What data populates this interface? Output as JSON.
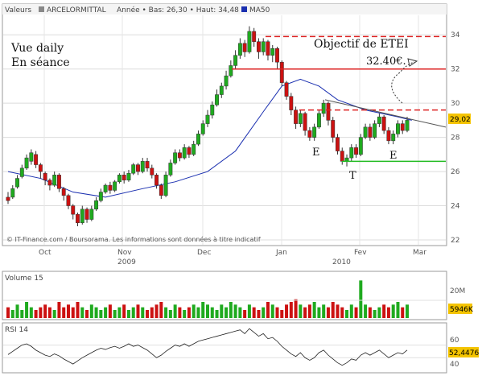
{
  "legend": {
    "label": "Valeurs",
    "name": "ARCELORMITTAL",
    "range": "Année • Bas: 26,30 • Haut: 34,48",
    "ma": "MA50"
  },
  "annotations": {
    "session1": "Vue daily",
    "session2": "En séance",
    "objective": "Objectif de ETEI",
    "target": "32.40€.",
    "e_left": "E",
    "t_bottom": "T",
    "e_right": "E",
    "credits": "© IT-Finance.com / Boursorama. Les informations sont données à titre indicatif"
  },
  "price_axis": {
    "ticks": [
      "22",
      "24",
      "26",
      "28",
      "30",
      "32",
      "34"
    ],
    "last": "29,02"
  },
  "months": [
    "Oct",
    "Nov",
    "Dec",
    "Jan",
    "Fev",
    "Mar"
  ],
  "years": [
    "2009",
    "2010"
  ],
  "volume_panel": {
    "title": "Volume 15",
    "tick": "20M",
    "last": "5946K"
  },
  "rsi_panel": {
    "title": "RSI 14",
    "ticks": [
      "60",
      "40"
    ],
    "last": "52,4476"
  },
  "colors": {
    "up": "#1faa1f",
    "down": "#cc1111",
    "ma": "#1a2fb0",
    "support": "#22bb22",
    "resistance": "#dd2222"
  },
  "chart_data": {
    "type": "candlestick",
    "title": "ARCELORMITTAL",
    "period": "daily, Sep 2009 - Feb 2010",
    "ylim": [
      22,
      35
    ],
    "candles": [
      [
        24.5,
        24.3,
        24.8,
        24.1
      ],
      [
        24.5,
        25.0,
        25.2,
        24.4
      ],
      [
        25.1,
        25.6,
        25.8,
        25.0
      ],
      [
        25.7,
        26.2,
        26.4,
        25.6
      ],
      [
        26.2,
        26.8,
        27.0,
        26.1
      ],
      [
        26.6,
        27.1,
        27.3,
        26.4
      ],
      [
        27.0,
        26.4,
        27.2,
        26.2
      ],
      [
        26.4,
        26.0,
        26.5,
        25.6
      ],
      [
        25.9,
        25.5,
        26.0,
        25.2
      ],
      [
        25.5,
        25.2,
        25.6,
        24.9
      ],
      [
        25.2,
        25.8,
        26.0,
        25.1
      ],
      [
        25.8,
        25.0,
        25.9,
        24.8
      ],
      [
        25.0,
        24.6,
        25.1,
        24.3
      ],
      [
        24.6,
        24.0,
        24.7,
        23.8
      ],
      [
        24.0,
        23.5,
        24.1,
        23.2
      ],
      [
        23.5,
        23.0,
        23.6,
        22.8
      ],
      [
        23.0,
        23.8,
        24.0,
        22.9
      ],
      [
        23.8,
        23.2,
        23.9,
        23.0
      ],
      [
        23.2,
        23.8,
        24.0,
        23.1
      ],
      [
        23.8,
        24.3,
        24.5,
        23.7
      ],
      [
        24.3,
        24.8,
        25.0,
        24.2
      ],
      [
        24.8,
        25.2,
        25.3,
        24.7
      ],
      [
        25.2,
        24.9,
        25.4,
        24.7
      ],
      [
        24.9,
        25.4,
        25.5,
        24.8
      ],
      [
        25.4,
        25.8,
        25.9,
        25.3
      ],
      [
        25.8,
        25.5,
        26.0,
        25.3
      ],
      [
        25.5,
        25.9,
        26.1,
        25.4
      ],
      [
        25.9,
        26.4,
        26.5,
        25.8
      ],
      [
        26.4,
        26.0,
        26.5,
        25.8
      ],
      [
        26.0,
        26.6,
        26.8,
        25.9
      ],
      [
        26.6,
        26.2,
        26.8,
        26.0
      ],
      [
        26.2,
        25.8,
        26.4,
        25.6
      ],
      [
        25.8,
        25.2,
        25.9,
        25.0
      ],
      [
        25.2,
        24.6,
        25.3,
        24.4
      ],
      [
        24.6,
        25.8,
        26.0,
        24.5
      ],
      [
        25.8,
        26.5,
        26.7,
        25.7
      ],
      [
        26.5,
        27.1,
        27.3,
        26.4
      ],
      [
        27.1,
        26.8,
        27.3,
        26.6
      ],
      [
        26.8,
        27.4,
        27.6,
        26.7
      ],
      [
        27.4,
        27.0,
        27.5,
        26.8
      ],
      [
        27.0,
        27.6,
        27.8,
        26.9
      ],
      [
        27.6,
        28.2,
        28.4,
        27.5
      ],
      [
        28.2,
        28.8,
        29.0,
        28.1
      ],
      [
        28.8,
        29.3,
        29.6,
        28.6
      ],
      [
        29.3,
        29.9,
        30.1,
        29.1
      ],
      [
        29.9,
        30.5,
        30.8,
        29.8
      ],
      [
        30.5,
        31.0,
        31.2,
        30.3
      ],
      [
        31.0,
        31.6,
        31.9,
        30.8
      ],
      [
        31.6,
        32.2,
        32.5,
        31.5
      ],
      [
        32.2,
        32.8,
        33.1,
        32.0
      ],
      [
        32.8,
        33.5,
        33.8,
        32.6
      ],
      [
        33.5,
        33.0,
        33.7,
        32.7
      ],
      [
        33.0,
        34.2,
        34.5,
        32.9
      ],
      [
        34.2,
        33.6,
        34.4,
        33.3
      ],
      [
        33.6,
        33.0,
        33.8,
        32.6
      ],
      [
        33.0,
        33.6,
        33.8,
        32.8
      ],
      [
        33.6,
        32.8,
        33.7,
        32.5
      ],
      [
        32.8,
        33.2,
        33.4,
        32.4
      ],
      [
        33.2,
        32.4,
        33.3,
        32.0
      ],
      [
        32.4,
        31.2,
        32.5,
        31.0
      ],
      [
        31.2,
        30.4,
        31.3,
        30.2
      ],
      [
        30.4,
        29.6,
        30.6,
        29.3
      ],
      [
        29.6,
        28.8,
        29.8,
        28.5
      ],
      [
        28.8,
        29.4,
        29.6,
        28.6
      ],
      [
        29.4,
        28.4,
        29.5,
        28.1
      ],
      [
        28.4,
        28.0,
        28.6,
        27.8
      ],
      [
        28.0,
        28.6,
        28.8,
        27.8
      ],
      [
        28.6,
        29.4,
        29.6,
        28.5
      ],
      [
        29.4,
        30.0,
        30.2,
        29.2
      ],
      [
        30.0,
        29.0,
        30.1,
        28.7
      ],
      [
        29.0,
        28.0,
        29.2,
        27.7
      ],
      [
        28.0,
        27.2,
        28.2,
        27.0
      ],
      [
        27.2,
        26.6,
        27.4,
        26.4
      ],
      [
        26.6,
        26.8,
        27.0,
        26.3
      ],
      [
        26.8,
        27.4,
        27.6,
        26.6
      ],
      [
        27.4,
        27.0,
        27.6,
        26.8
      ],
      [
        27.0,
        28.0,
        28.2,
        26.9
      ],
      [
        28.0,
        28.6,
        28.8,
        27.9
      ],
      [
        28.6,
        28.0,
        28.8,
        27.8
      ],
      [
        28.0,
        28.8,
        29.0,
        27.9
      ],
      [
        28.8,
        29.2,
        29.4,
        28.6
      ],
      [
        29.2,
        28.4,
        29.3,
        28.2
      ],
      [
        28.4,
        27.8,
        28.6,
        27.6
      ],
      [
        27.8,
        28.2,
        28.4,
        27.6
      ],
      [
        28.2,
        28.8,
        29.0,
        28.0
      ],
      [
        28.8,
        28.4,
        29.0,
        28.2
      ],
      [
        28.4,
        29.0,
        29.2,
        28.3
      ]
    ],
    "ma50": [
      [
        1,
        26.0
      ],
      [
        8,
        25.6
      ],
      [
        15,
        24.8
      ],
      [
        22,
        24.5
      ],
      [
        30,
        25.0
      ],
      [
        37,
        25.4
      ],
      [
        44,
        26.0
      ],
      [
        50,
        27.2
      ],
      [
        56,
        29.5
      ],
      [
        60,
        31.0
      ],
      [
        64,
        31.4
      ],
      [
        68,
        31.0
      ],
      [
        72,
        30.2
      ],
      [
        78,
        29.6
      ],
      [
        85,
        29.2
      ],
      [
        88,
        29.0
      ]
    ],
    "resistance_objective": 33.9,
    "line_32_4": 32.0,
    "line_29_6": 29.6,
    "support": 26.6,
    "volume": [
      4,
      3,
      5,
      3,
      6,
      4,
      3,
      4,
      5,
      4,
      3,
      6,
      4,
      5,
      4,
      6,
      4,
      3,
      5,
      4,
      3,
      4,
      5,
      3,
      4,
      5,
      3,
      4,
      5,
      4,
      3,
      4,
      5,
      6,
      4,
      3,
      5,
      4,
      3,
      4,
      5,
      4,
      6,
      5,
      4,
      3,
      5,
      4,
      6,
      5,
      4,
      3,
      5,
      4,
      3,
      4,
      6,
      5,
      4,
      3,
      5,
      6,
      7,
      5,
      4,
      5,
      6,
      4,
      5,
      4,
      6,
      5,
      4,
      3,
      5,
      4,
      14,
      5,
      4,
      3,
      4,
      5,
      4,
      5,
      6,
      4,
      5
    ],
    "rsi": [
      45,
      50,
      55,
      60,
      62,
      58,
      52,
      48,
      44,
      42,
      46,
      43,
      38,
      34,
      30,
      35,
      40,
      44,
      48,
      52,
      55,
      53,
      56,
      58,
      55,
      58,
      62,
      58,
      60,
      56,
      52,
      46,
      40,
      44,
      50,
      55,
      60,
      58,
      62,
      58,
      62,
      66,
      68,
      70,
      72,
      74,
      76,
      78,
      80,
      82,
      84,
      78,
      86,
      80,
      74,
      78,
      70,
      72,
      66,
      58,
      52,
      46,
      42,
      48,
      40,
      36,
      40,
      48,
      52,
      44,
      38,
      32,
      28,
      32,
      38,
      36,
      44,
      48,
      44,
      48,
      52,
      46,
      40,
      44,
      48,
      46,
      52
    ]
  }
}
